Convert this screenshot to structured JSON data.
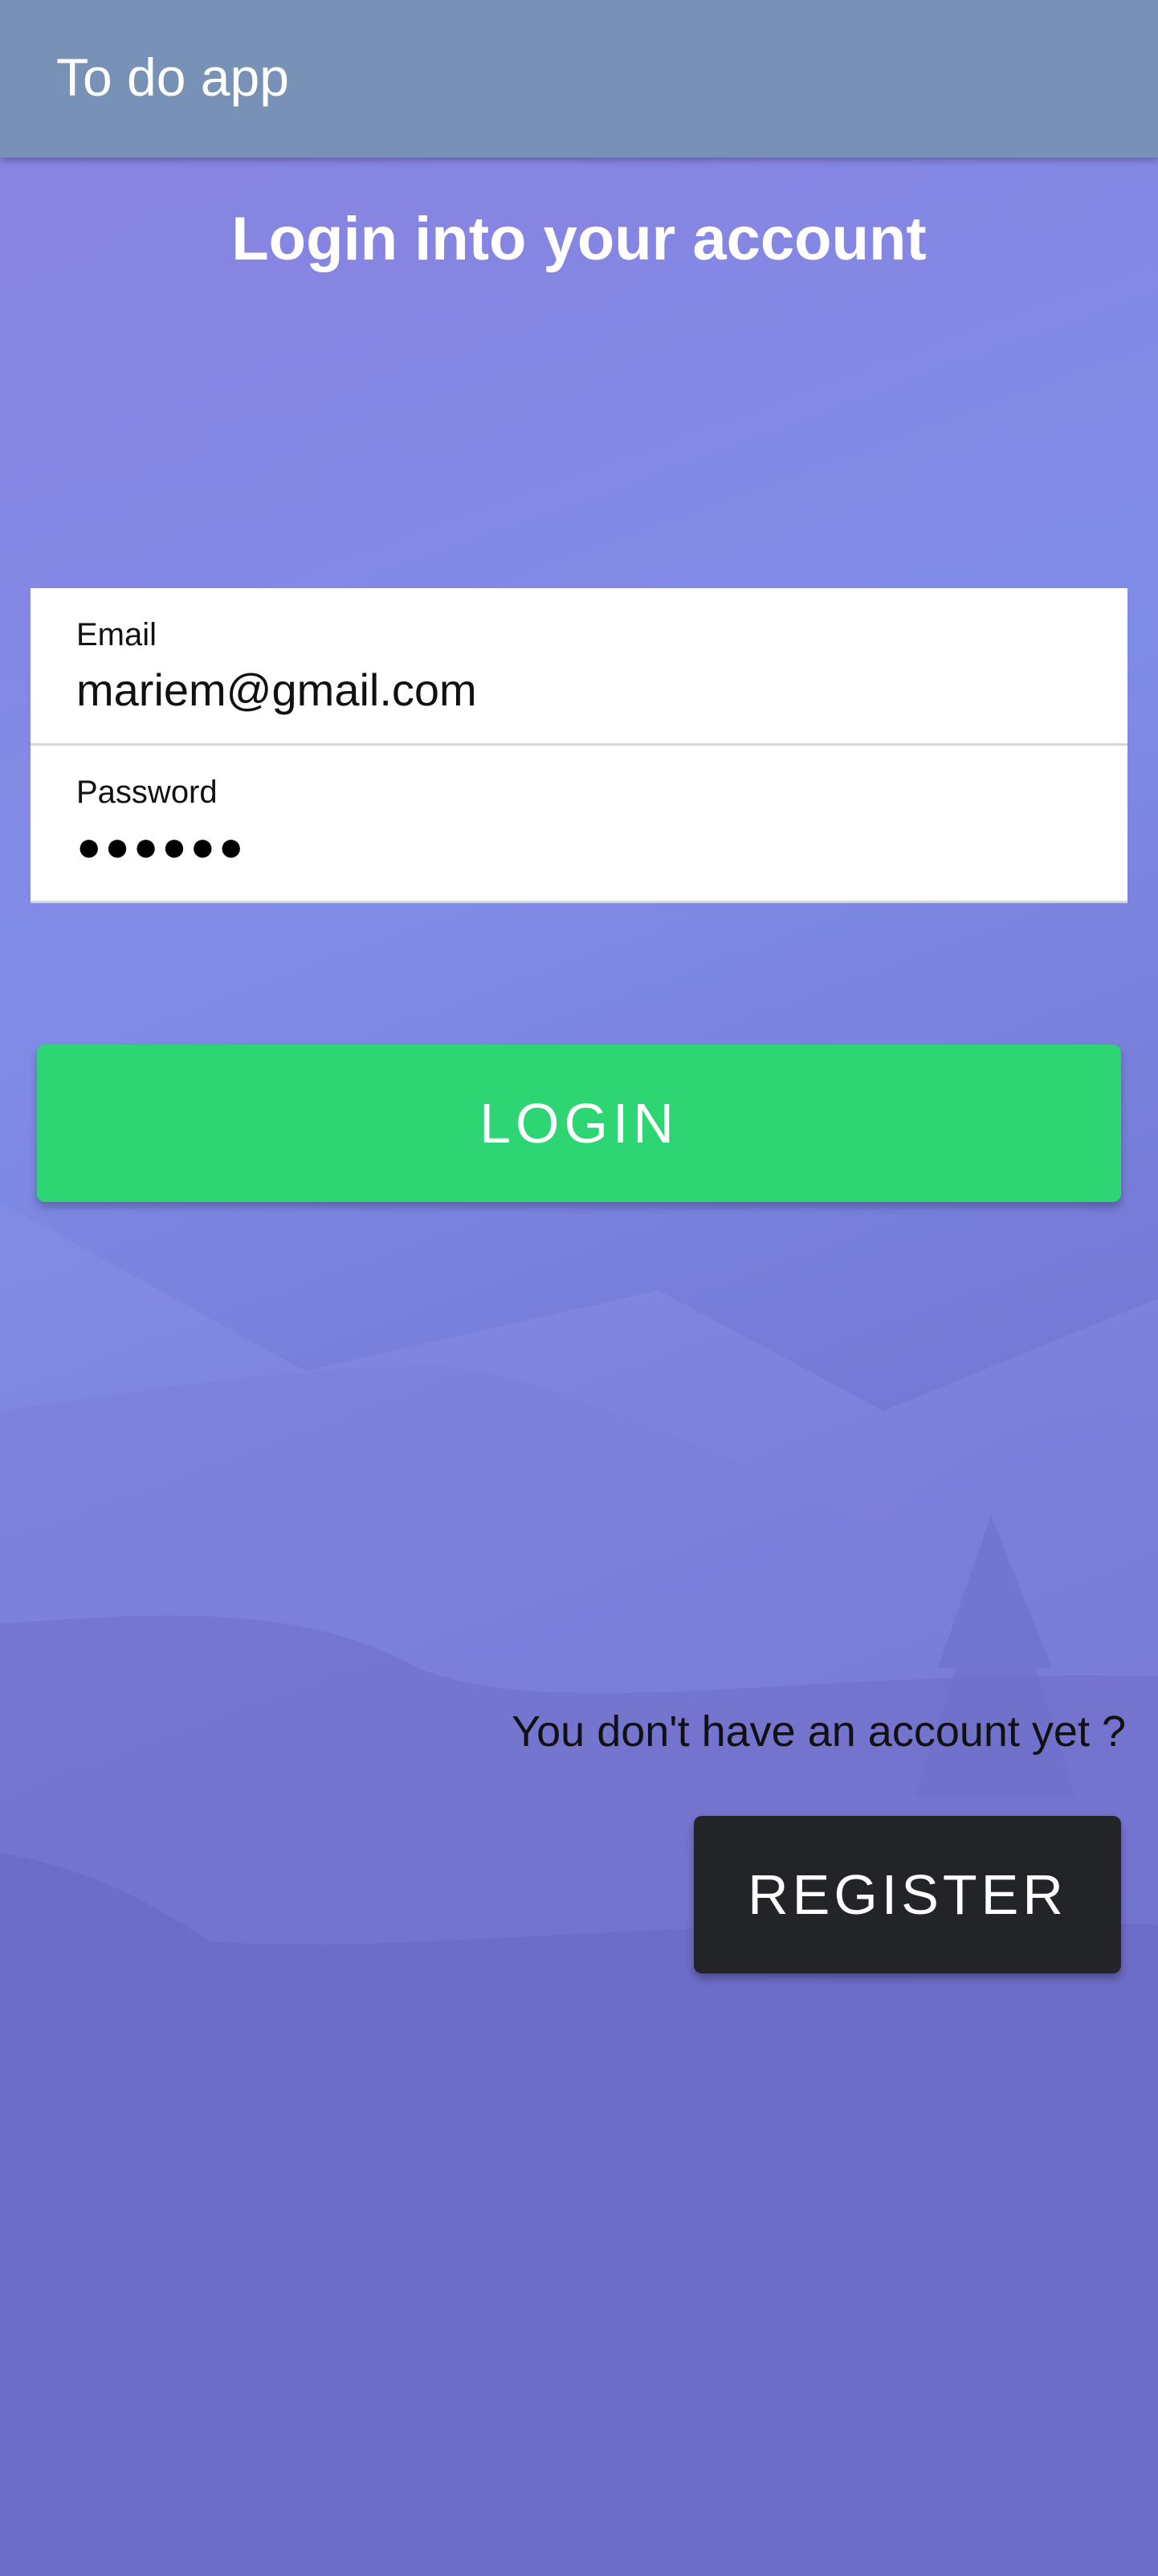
{
  "app_bar": {
    "title": "To do app"
  },
  "main": {
    "heading": "Login into your account",
    "email": {
      "label": "Email",
      "value": "mariem@gmail.com"
    },
    "password": {
      "label": "Password",
      "masked_value": "●●●●●●"
    },
    "login_label": "LOGIN",
    "register_prompt": "You don't have an account yet ?",
    "register_label": "REGISTER"
  },
  "colors": {
    "app_bar": "#7891b6",
    "login_button": "#2ed573",
    "register_button": "#232427"
  }
}
